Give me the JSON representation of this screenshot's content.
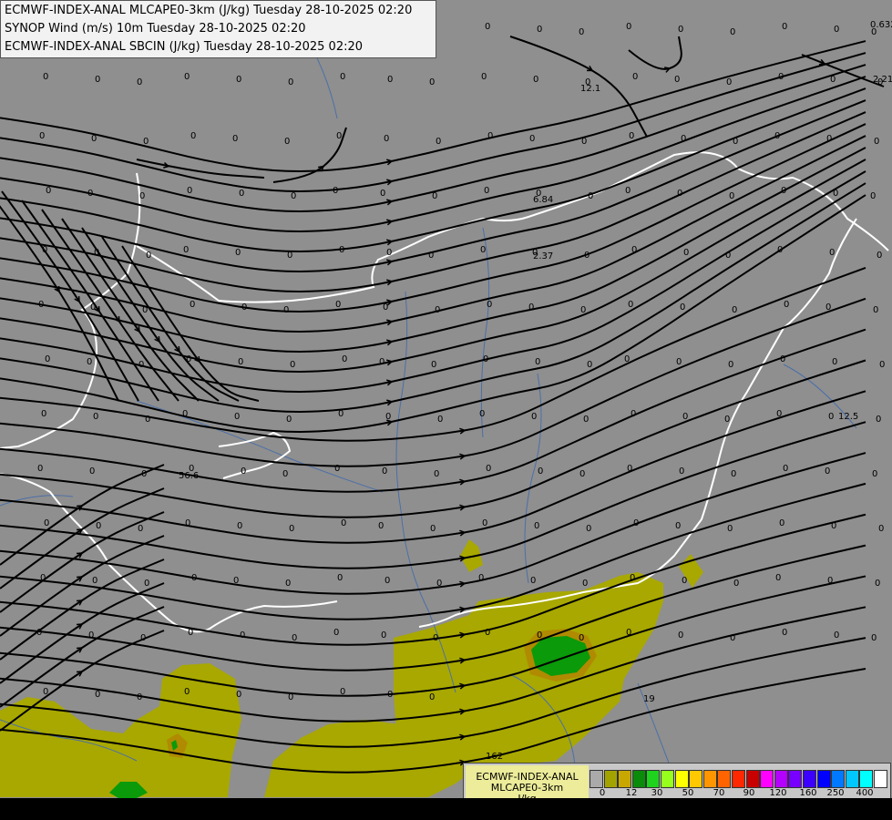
{
  "titles": [
    "ECMWF-INDEX-ANAL MLCAPE0-3km (J/kg) Tuesday 28-10-2025 02:20",
    "SYNOP Wind (m/s) 10m Tuesday 28-10-2025 02:20",
    "ECMWF-INDEX-ANAL SBCIN (J/kg) Tuesday 28-10-2025 02:20"
  ],
  "legend": {
    "model": "ECMWF-INDEX-ANAL",
    "parameter": "MLCAPE0-3km",
    "unit": "J/kg",
    "ticks": [
      "0",
      "12",
      "30",
      "50",
      "70",
      "90",
      "120",
      "160",
      "250",
      "400"
    ],
    "colors": [
      "#aaaaaa",
      "#a3a300",
      "#c8a800",
      "#0a8c0a",
      "#1ed21e",
      "#96ff1e",
      "#ffff00",
      "#ffc800",
      "#ff9600",
      "#ff6400",
      "#ff2800",
      "#c80000",
      "#ff00ff",
      "#b400ff",
      "#7800ff",
      "#3c00ff",
      "#0000ff",
      "#0078ff",
      "#00c8ff",
      "#00ffff",
      "#ffffff"
    ]
  },
  "map_colors": {
    "background": "#8f8f8f",
    "cape_low": "#a8a800",
    "cape_mid": "#0a9a0a",
    "cape_edge": "#b08a00",
    "border": "#ffffff",
    "rivers": "#4b6fa8",
    "streamline": "#000000"
  },
  "station_values": [
    {
      "v": "0"
    },
    {
      "v": "0"
    },
    {
      "v": "0"
    },
    {
      "v": "0"
    },
    {
      "v": "0"
    },
    {
      "v": "0"
    },
    {
      "v": "0"
    },
    {
      "v": "0"
    },
    {
      "v": "0"
    },
    {
      "v": "0"
    },
    {
      "v": "0"
    },
    {
      "v": "0"
    },
    {
      "v": "0"
    },
    {
      "v": "0"
    },
    {
      "v": "0"
    },
    {
      "v": "0"
    },
    {
      "v": "0"
    },
    {
      "v": "0"
    },
    {
      "v": "0"
    },
    {
      "v": "0"
    },
    {
      "v": "0"
    },
    {
      "v": "0"
    },
    {
      "v": "0"
    },
    {
      "v": "0"
    },
    {
      "v": "0"
    },
    {
      "v": "0"
    },
    {
      "v": "0"
    },
    {
      "v": "0"
    },
    {
      "v": "0"
    },
    {
      "v": "0"
    },
    {
      "v": "0"
    },
    {
      "v": "0"
    },
    {
      "v": "0"
    },
    {
      "v": "0"
    },
    {
      "v": "0"
    },
    {
      "v": "0"
    },
    {
      "v": "0"
    },
    {
      "v": "0"
    },
    {
      "v": "0"
    },
    {
      "v": "0"
    },
    {
      "v": "0"
    },
    {
      "v": "0"
    },
    {
      "v": "0"
    },
    {
      "v": "0"
    },
    {
      "v": "0"
    },
    {
      "v": "0"
    },
    {
      "v": "0"
    },
    {
      "v": "0"
    },
    {
      "v": "0"
    },
    {
      "v": "0"
    },
    {
      "v": "0"
    },
    {
      "v": "0"
    },
    {
      "v": "0"
    },
    {
      "v": "0"
    },
    {
      "v": "0"
    },
    {
      "v": "0"
    },
    {
      "v": "0"
    },
    {
      "v": "0"
    },
    {
      "v": "0"
    },
    {
      "v": "0"
    },
    {
      "v": "0"
    },
    {
      "v": "0"
    },
    {
      "v": "0"
    },
    {
      "v": "0"
    },
    {
      "v": "0"
    },
    {
      "v": "0"
    },
    {
      "v": "0"
    },
    {
      "v": "0"
    },
    {
      "v": "0"
    },
    {
      "v": "0"
    },
    {
      "v": "0"
    },
    {
      "v": "0"
    },
    {
      "v": "0"
    },
    {
      "v": "0"
    },
    {
      "v": "0"
    },
    {
      "v": "0"
    },
    {
      "v": "0"
    },
    {
      "v": "0"
    },
    {
      "v": "0"
    },
    {
      "v": "0"
    },
    {
      "v": "0"
    },
    {
      "v": "0"
    },
    {
      "v": "0"
    },
    {
      "v": "0"
    },
    {
      "v": "0"
    },
    {
      "v": "0"
    },
    {
      "v": "0"
    },
    {
      "v": "0"
    },
    {
      "v": "0"
    },
    {
      "v": "0"
    },
    {
      "v": "0"
    },
    {
      "v": "0"
    },
    {
      "v": "0"
    },
    {
      "v": "0"
    },
    {
      "v": "0"
    },
    {
      "v": "0"
    },
    {
      "v": "0"
    },
    {
      "v": "0"
    },
    {
      "v": "0"
    },
    {
      "v": "0"
    },
    {
      "v": "0"
    },
    {
      "v": "0"
    },
    {
      "v": "0"
    },
    {
      "v": "0"
    },
    {
      "v": "0"
    },
    {
      "v": "0"
    },
    {
      "v": "0"
    },
    {
      "v": "0"
    },
    {
      "v": "0"
    },
    {
      "v": "0"
    },
    {
      "v": "0"
    },
    {
      "v": "0"
    },
    {
      "v": "0"
    },
    {
      "v": "0"
    },
    {
      "v": "0"
    },
    {
      "v": "0"
    },
    {
      "v": "0"
    },
    {
      "v": "0"
    },
    {
      "v": "0"
    },
    {
      "v": "0"
    },
    {
      "v": "0"
    },
    {
      "v": "0"
    },
    {
      "v": "0"
    },
    {
      "v": "0"
    },
    {
      "v": "0"
    },
    {
      "v": "0"
    },
    {
      "v": "0"
    },
    {
      "v": "0"
    },
    {
      "v": "0"
    },
    {
      "v": "0"
    },
    {
      "v": "0"
    },
    {
      "v": "0"
    },
    {
      "v": "0"
    },
    {
      "v": "0"
    },
    {
      "v": "0"
    },
    {
      "v": "0"
    },
    {
      "v": "0"
    },
    {
      "v": "0"
    },
    {
      "v": "0"
    },
    {
      "v": "0"
    },
    {
      "v": "0"
    },
    {
      "v": "0"
    },
    {
      "v": "0"
    },
    {
      "v": "0"
    },
    {
      "v": "0"
    },
    {
      "v": "0"
    },
    {
      "v": "0"
    },
    {
      "v": "0"
    },
    {
      "v": "0"
    },
    {
      "v": "0"
    },
    {
      "v": "0"
    },
    {
      "v": "0"
    },
    {
      "v": "0"
    },
    {
      "v": "0"
    },
    {
      "v": "0"
    },
    {
      "v": "0"
    },
    {
      "v": "0"
    },
    {
      "v": "0"
    },
    {
      "v": "0"
    },
    {
      "v": "0"
    },
    {
      "v": "0"
    },
    {
      "v": "0"
    },
    {
      "v": "0"
    },
    {
      "v": "0"
    },
    {
      "v": "0"
    },
    {
      "v": "0"
    },
    {
      "v": "0"
    },
    {
      "v": "0"
    },
    {
      "v": "0"
    },
    {
      "v": "0"
    },
    {
      "v": "0"
    },
    {
      "v": "0"
    },
    {
      "v": "0"
    },
    {
      "v": "0"
    },
    {
      "v": "0"
    },
    {
      "v": "0"
    },
    {
      "v": "0"
    },
    {
      "v": "0"
    },
    {
      "v": "0"
    },
    {
      "v": "0"
    },
    {
      "v": "0"
    },
    {
      "v": "0"
    },
    {
      "v": "0"
    },
    {
      "v": "0"
    },
    {
      "v": "0"
    },
    {
      "v": "0"
    },
    {
      "v": "0"
    },
    {
      "v": "0"
    },
    {
      "v": "0"
    },
    {
      "v": "0"
    },
    {
      "v": "0"
    },
    {
      "v": "0"
    },
    {
      "v": "0"
    },
    {
      "v": "0"
    },
    {
      "v": "0"
    },
    {
      "v": "0"
    },
    {
      "v": "0"
    },
    {
      "v": "0"
    },
    {
      "v": "0"
    },
    {
      "v": "0"
    },
    {
      "v": "0"
    },
    {
      "v": "0"
    },
    {
      "v": "0"
    },
    {
      "v": "0"
    },
    {
      "v": "0"
    },
    {
      "v": "0"
    },
    {
      "v": "0"
    },
    {
      "v": "0"
    },
    {
      "v": "0"
    },
    {
      "v": "0"
    },
    {
      "v": "0"
    },
    {
      "v": "0"
    },
    {
      "v": "0"
    },
    {
      "v": "0"
    },
    {
      "v": "0"
    },
    {
      "v": "0"
    },
    {
      "v": "0.632"
    },
    {
      "v": "2.21"
    },
    {
      "v": "12.1"
    },
    {
      "v": "6.84"
    },
    {
      "v": "2.37"
    },
    {
      "v": "12.5"
    },
    {
      "v": "56.6"
    },
    {
      "v": "19"
    },
    {
      "v": "162"
    }
  ]
}
